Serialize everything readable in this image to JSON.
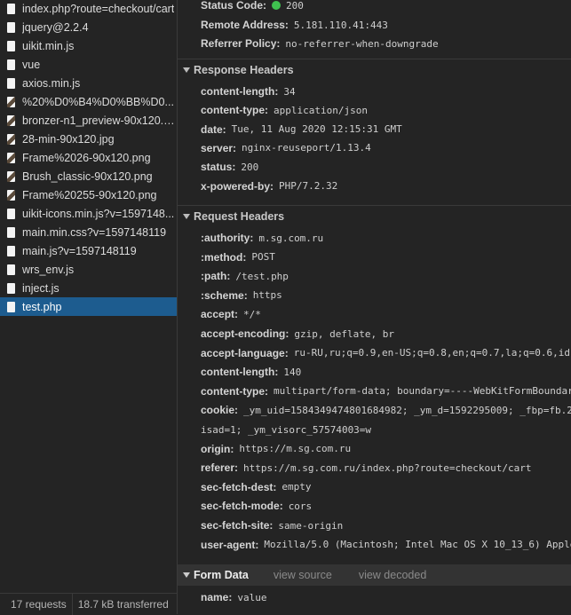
{
  "sidebar": {
    "files": [
      {
        "name": "index.php?route=checkout/cart",
        "icon": "document-icon",
        "selected": false
      },
      {
        "name": "jquery@2.2.4",
        "icon": "document-icon",
        "selected": false
      },
      {
        "name": "uikit.min.js",
        "icon": "document-icon",
        "selected": false
      },
      {
        "name": "vue",
        "icon": "document-icon",
        "selected": false
      },
      {
        "name": "axios.min.js",
        "icon": "document-icon",
        "selected": false
      },
      {
        "name": "%20%D0%B4%D0%BB%D0...",
        "icon": "image-icon",
        "selected": false
      },
      {
        "name": "bronzer-n1_preview-90x120.jpg",
        "icon": "image-icon",
        "selected": false
      },
      {
        "name": "28-min-90x120.jpg",
        "icon": "image-icon",
        "selected": false
      },
      {
        "name": "Frame%2026-90x120.png",
        "icon": "image-icon",
        "selected": false
      },
      {
        "name": "Brush_classic-90x120.png",
        "icon": "image-icon",
        "selected": false
      },
      {
        "name": "Frame%20255-90x120.png",
        "icon": "image-icon",
        "selected": false
      },
      {
        "name": "uikit-icons.min.js?v=1597148...",
        "icon": "document-icon",
        "selected": false
      },
      {
        "name": "main.min.css?v=1597148119",
        "icon": "document-icon",
        "selected": false
      },
      {
        "name": "main.js?v=1597148119",
        "icon": "document-icon",
        "selected": false
      },
      {
        "name": "wrs_env.js",
        "icon": "document-icon",
        "selected": false
      },
      {
        "name": "inject.js",
        "icon": "document-icon",
        "selected": false
      },
      {
        "name": "test.php",
        "icon": "document-icon",
        "selected": true
      }
    ],
    "status": {
      "requests": "17 requests",
      "transferred": "18.7 kB transferred"
    }
  },
  "general": {
    "status_code_key": "Status Code:",
    "status_code_value": "200",
    "status_color": "#3fc04f",
    "remote_address_key": "Remote Address:",
    "remote_address_value": "5.181.110.41:443",
    "referrer_policy_key": "Referrer Policy:",
    "referrer_policy_value": "no-referrer-when-downgrade"
  },
  "response_headers": {
    "title": "Response Headers",
    "items": [
      {
        "key": "content-length:",
        "value": "34"
      },
      {
        "key": "content-type:",
        "value": "application/json"
      },
      {
        "key": "date:",
        "value": "Tue, 11 Aug 2020 12:15:31 GMT"
      },
      {
        "key": "server:",
        "value": "nginx-reuseport/1.13.4"
      },
      {
        "key": "status:",
        "value": "200"
      },
      {
        "key": "x-powered-by:",
        "value": "PHP/7.2.32"
      }
    ]
  },
  "request_headers": {
    "title": "Request Headers",
    "items": [
      {
        "key": ":authority:",
        "value": "m.sg.com.ru"
      },
      {
        "key": ":method:",
        "value": "POST"
      },
      {
        "key": ":path:",
        "value": "/test.php"
      },
      {
        "key": ":scheme:",
        "value": "https"
      },
      {
        "key": "accept:",
        "value": "*/*"
      },
      {
        "key": "accept-encoding:",
        "value": "gzip, deflate, br"
      },
      {
        "key": "accept-language:",
        "value": "ru-RU,ru;q=0.9,en-US;q=0.8,en;q=0.7,la;q=0.6,id"
      },
      {
        "key": "content-length:",
        "value": "140"
      },
      {
        "key": "content-type:",
        "value": "multipart/form-data; boundary=----WebKitFormBoundar"
      },
      {
        "key": "cookie:",
        "value": "_ym_uid=1584349474801684982; _ym_d=1592295009; _fbp=fb.2"
      },
      {
        "key": "",
        "value": "isad=1; _ym_visorc_57574003=w"
      },
      {
        "key": "origin:",
        "value": "https://m.sg.com.ru"
      },
      {
        "key": "referer:",
        "value": "https://m.sg.com.ru/index.php?route=checkout/cart"
      },
      {
        "key": "sec-fetch-dest:",
        "value": "empty"
      },
      {
        "key": "sec-fetch-mode:",
        "value": "cors"
      },
      {
        "key": "sec-fetch-site:",
        "value": "same-origin"
      },
      {
        "key": "user-agent:",
        "value": "Mozilla/5.0 (Macintosh; Intel Mac OS X 10_13_6) Apple"
      }
    ]
  },
  "form_data": {
    "title": "Form Data",
    "view_source": "view source",
    "view_decoded": "view decoded",
    "items": [
      {
        "key": "name:",
        "value": "value"
      }
    ]
  }
}
